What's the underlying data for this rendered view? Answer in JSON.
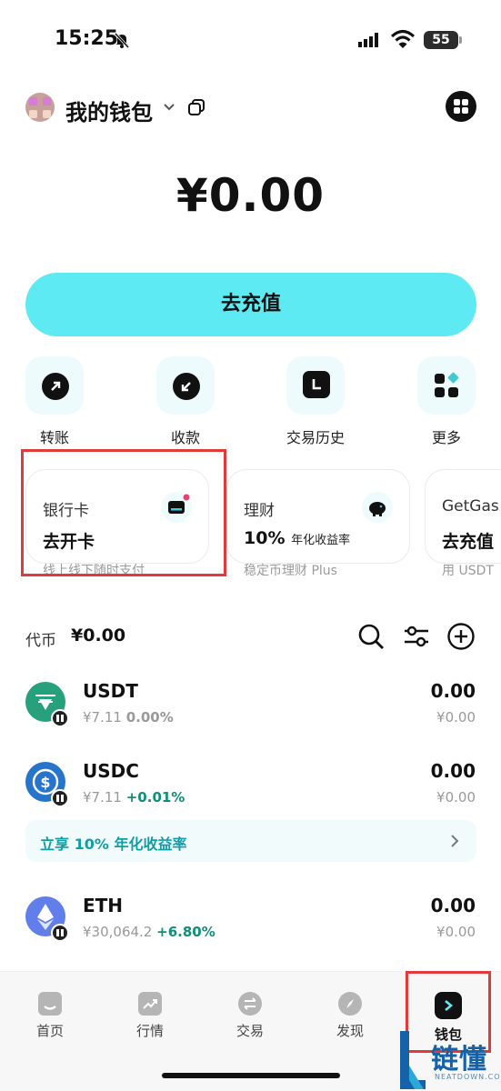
{
  "status_bar": {
    "time": "15:25",
    "battery": "55"
  },
  "header": {
    "title": "我的钱包"
  },
  "balance": "¥0.00",
  "recharge_label": "去充值",
  "actions": [
    {
      "label": "转账",
      "icon": "arrow-up-right-icon"
    },
    {
      "label": "收款",
      "icon": "arrow-down-left-icon"
    },
    {
      "label": "交易历史",
      "icon": "clock-icon"
    },
    {
      "label": "更多",
      "icon": "grid-icon"
    }
  ],
  "cards": [
    {
      "title": "银行卡",
      "main": "去开卡",
      "sub": "线上线下随时支付",
      "icon": "card-icon"
    },
    {
      "title": "理财",
      "main": "10%",
      "main_suffix": "年化收益率",
      "sub": "稳定币理财 Plus",
      "icon": "piggy-bank-icon"
    },
    {
      "title": "GetGas",
      "main": "去充值",
      "sub": "用 USDT"
    }
  ],
  "tokens_header": {
    "label": "代币",
    "total": "¥0.00"
  },
  "tokens": [
    {
      "name": "USDT",
      "price": "¥7.11",
      "change": "0.00%",
      "amount": "0.00",
      "value": "¥0.00",
      "color": "#26a17b"
    },
    {
      "name": "USDC",
      "price": "¥7.11",
      "change": "+0.01%",
      "amount": "0.00",
      "value": "¥0.00",
      "color": "#2775ca"
    },
    {
      "name": "ETH",
      "price": "¥30,064.2",
      "change": "+6.80%",
      "amount": "0.00",
      "value": "¥0.00",
      "color": "#627eea"
    }
  ],
  "promo": {
    "text": "立享 10% 年化收益率"
  },
  "tabs": [
    {
      "label": "首页"
    },
    {
      "label": "行情"
    },
    {
      "label": "交易"
    },
    {
      "label": "发现"
    },
    {
      "label": "钱包"
    }
  ],
  "watermark": {
    "text": "链懂",
    "sub": "NEATDOWN.COM"
  },
  "colors": {
    "accent": "#5eeaf2",
    "positive": "#0f8f7a",
    "highlight_box": "#e23a3a"
  }
}
